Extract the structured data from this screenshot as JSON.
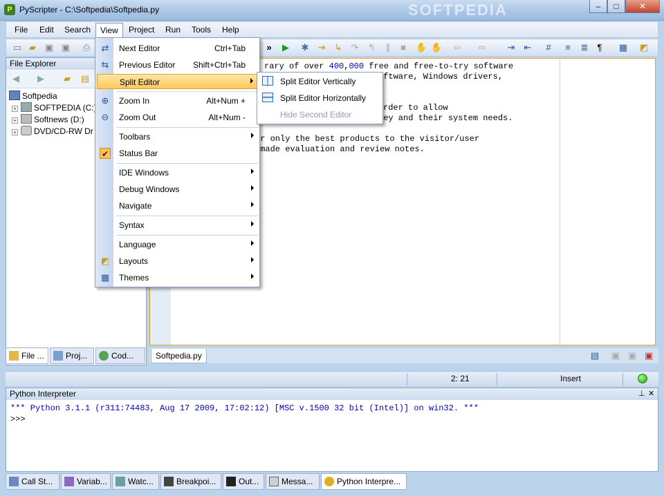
{
  "window": {
    "title": "PyScripter - C:\\Softpedia\\Softpedia.py",
    "app_icon_glyph": "P",
    "controls": {
      "minimize": "–",
      "maximize": "□",
      "close": "✕"
    },
    "watermark": "SOFTPEDIA"
  },
  "menubar": {
    "items": [
      "File",
      "Edit",
      "Search",
      "View",
      "Project",
      "Run",
      "Tools",
      "Help"
    ],
    "active": "View"
  },
  "toolbar": {
    "overflow": "»"
  },
  "file_explorer": {
    "title": "File Explorer",
    "tree": [
      {
        "label": "Softpedia",
        "icon": "computer-icon"
      },
      {
        "label": "SOFTPEDIA (C:)",
        "icon": "hard-drive-icon"
      },
      {
        "label": "Softnews (D:)",
        "icon": "hard-drive-icon"
      },
      {
        "label": "DVD/CD-RW Dr",
        "icon": "dvd-drive-icon"
      }
    ],
    "tabs": [
      "File ...",
      "Proj...",
      "Cod..."
    ]
  },
  "editor": {
    "tab": "Softpedia.py",
    "lines": [
      {
        "a": "rary of over ",
        "n1": "400",
        "b": ",",
        "n2": "000",
        "c": " free and free-to-try software"
      },
      {
        "a": "oftware, Windows drivers,"
      },
      {
        "a": ""
      },
      {
        "a": ""
      },
      {
        "a": "rder to allow"
      },
      {
        "a": "hey and their system needs."
      },
      {
        "a": ""
      },
      {
        "a": "er only the best products to the visitor/user"
      },
      {
        "a": "-made evaluation and review notes."
      }
    ]
  },
  "statusbar": {
    "position": "2: 21",
    "mode": "Insert"
  },
  "interpreter": {
    "title": "Python Interpreter",
    "pin": "⊥",
    "close": "✕",
    "banner": "*** Python 3.1.1 (r311:74483, Aug 17 2009, 17:02:12) [MSC v.1500 32 bit (Intel)] on win32. ***",
    "prompt": ">>>",
    "tabs": [
      "Call St...",
      "Variab...",
      "Watc...",
      "Breakpoi...",
      "Out...",
      "Messa...",
      "Python Interpre..."
    ]
  },
  "view_menu": {
    "items": [
      {
        "label": "Next Editor",
        "shortcut": "Ctrl+Tab",
        "icon": "next-editor-icon"
      },
      {
        "label": "Previous Editor",
        "shortcut": "Shift+Ctrl+Tab",
        "icon": "previous-editor-icon"
      },
      {
        "label": "Split Editor",
        "submenu": true
      },
      {
        "label": "Zoom In",
        "shortcut": "Alt+Num +",
        "icon": "zoom-in-icon"
      },
      {
        "label": "Zoom Out",
        "shortcut": "Alt+Num -",
        "icon": "zoom-out-icon"
      },
      {
        "label": "Toolbars",
        "submenu": true
      },
      {
        "label": "Status Bar",
        "checked": true
      },
      {
        "label": "IDE Windows",
        "submenu": true
      },
      {
        "label": "Debug Windows",
        "submenu": true
      },
      {
        "label": "Navigate",
        "submenu": true
      },
      {
        "label": "Syntax",
        "submenu": true
      },
      {
        "label": "Language",
        "submenu": true
      },
      {
        "label": "Layouts",
        "submenu": true,
        "icon": "layouts-icon"
      },
      {
        "label": "Themes",
        "submenu": true,
        "icon": "themes-icon"
      }
    ]
  },
  "split_submenu": {
    "items": [
      {
        "label": "Split Editor Vertically"
      },
      {
        "label": "Split Editor Horizontally"
      },
      {
        "label": "Hide Second Editor",
        "disabled": true
      }
    ]
  },
  "colors": {
    "accent": "#ffc75a",
    "code_number": "#0000c0",
    "interpreter_text": "#0000c0",
    "editor_border": "#e8a030"
  }
}
